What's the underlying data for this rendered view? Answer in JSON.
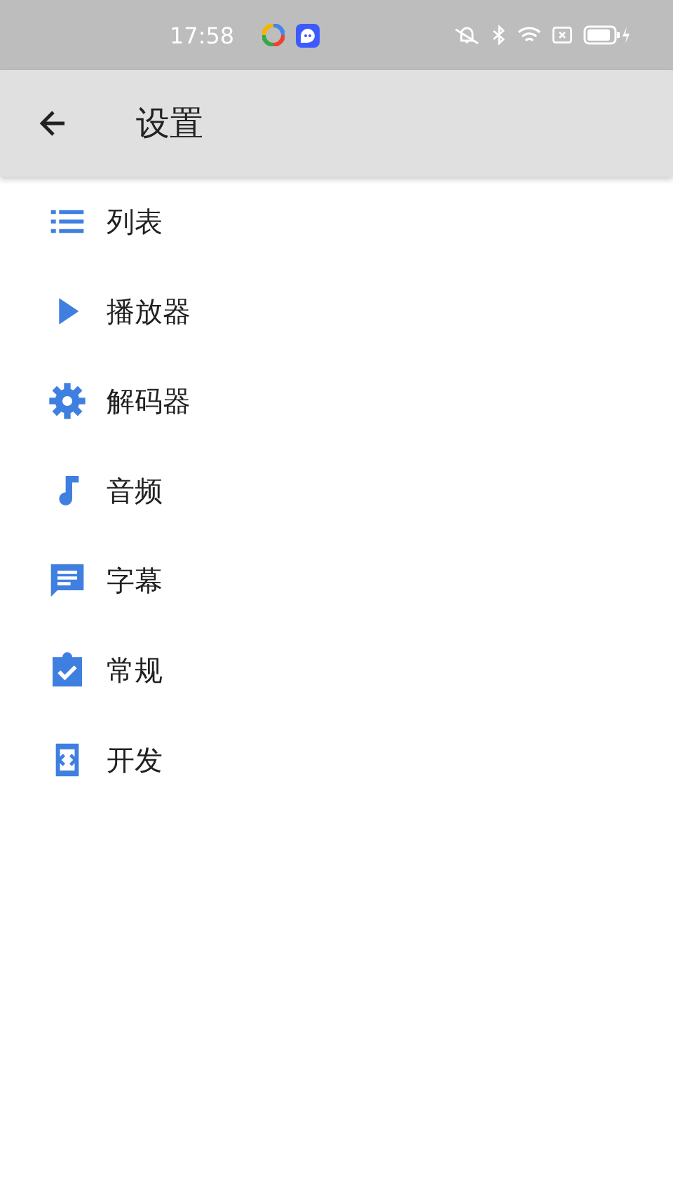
{
  "status_bar": {
    "time": "17:58"
  },
  "app_bar": {
    "title": "设置"
  },
  "items": [
    {
      "kind": "list",
      "label": "列表"
    },
    {
      "kind": "play",
      "label": "播放器"
    },
    {
      "kind": "gear",
      "label": "解码器"
    },
    {
      "kind": "note",
      "label": "音频"
    },
    {
      "kind": "subtitle",
      "label": "字幕"
    },
    {
      "kind": "check",
      "label": "常规"
    },
    {
      "kind": "dev",
      "label": "开发"
    }
  ]
}
